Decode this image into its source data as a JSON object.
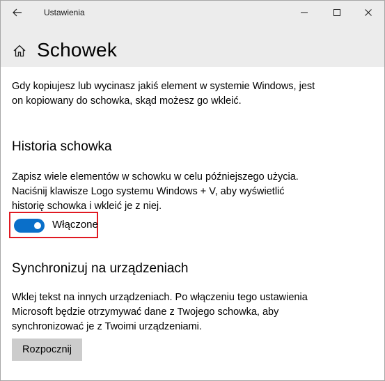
{
  "window": {
    "title": "Ustawienia",
    "controls": {
      "back": "back-arrow-icon",
      "minimize": "minimize-icon",
      "maximize": "maximize-icon",
      "close": "close-icon"
    }
  },
  "header": {
    "home_icon": "home-icon",
    "title": "Schowek"
  },
  "intro": {
    "line1": "Gdy kopiujesz lub wycinasz jakiś element w systemie Windows, jest",
    "line2": "on kopiowany do schowka, skąd możesz go wkleić."
  },
  "history": {
    "title": "Historia schowka",
    "line1": "Zapisz wiele elementów w schowku w celu późniejszego użycia.",
    "line2": "Naciśnij klawisze Logo systemu Windows + V, aby wyświetlić",
    "line3": "historię schowka i wkleić je z niej.",
    "toggle_state": "on",
    "toggle_label": "Włączone"
  },
  "sync": {
    "title": "Synchronizuj na urządzeniach",
    "line1": "Wklej tekst na innych urządzeniach. Po włączeniu tego ustawienia",
    "line2": "Microsoft będzie otrzymywać dane z Twojego schowka, aby",
    "line3": "synchronizować je z Twoimi urządzeniami.",
    "button_label": "Rozpocznij"
  },
  "colors": {
    "accent": "#0a6fc9",
    "highlight_border": "#e01a22",
    "titlebar_bg": "#ececec",
    "button_bg": "#cccccc"
  }
}
